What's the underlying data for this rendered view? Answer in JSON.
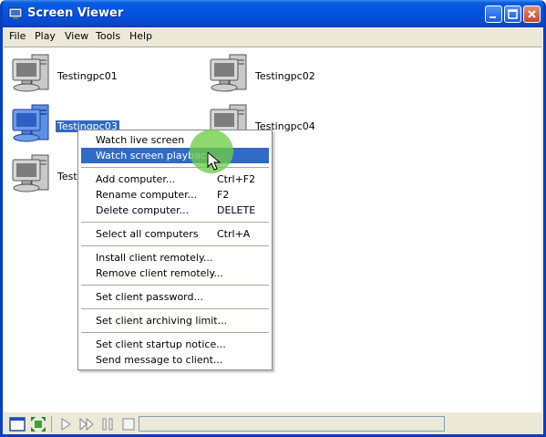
{
  "window": {
    "title": "Screen Viewer"
  },
  "menubar": [
    "File",
    "Play",
    "View",
    "Tools",
    "Help"
  ],
  "computers": [
    {
      "name": "Testingpc01",
      "selected": false
    },
    {
      "name": "Testingpc02",
      "selected": false
    },
    {
      "name": "Testingpc03",
      "selected": true
    },
    {
      "name": "Testingpc04",
      "selected": false
    },
    {
      "name": "Test",
      "selected": false
    }
  ],
  "context_menu": {
    "items": [
      {
        "label": "Watch live screen",
        "shortcut": ""
      },
      {
        "label": "Watch screen playback...",
        "shortcut": "",
        "highlighted": true
      },
      {
        "label": "Add computer...",
        "shortcut": "Ctrl+F2"
      },
      {
        "label": "Rename computer...",
        "shortcut": "F2"
      },
      {
        "label": "Delete computer...",
        "shortcut": "DELETE"
      },
      {
        "label": "Select all computers",
        "shortcut": "Ctrl+A"
      },
      {
        "label": "Install client remotely...",
        "shortcut": ""
      },
      {
        "label": "Remove client remotely...",
        "shortcut": ""
      },
      {
        "label": "Set client password...",
        "shortcut": ""
      },
      {
        "label": "Set client archiving limit...",
        "shortcut": ""
      },
      {
        "label": "Set client startup notice...",
        "shortcut": ""
      },
      {
        "label": "Send message to client...",
        "shortcut": ""
      }
    ]
  },
  "colors": {
    "titlebar": "#0a5ddc",
    "highlight": "#316ac5",
    "selected_pc": "#3d7be0"
  },
  "icons": [
    "app-icon",
    "minimize-icon",
    "maximize-icon",
    "close-icon",
    "computer-icon",
    "normal-view-icon",
    "fullscreen-icon",
    "play-icon",
    "fast-forward-icon",
    "pause-icon",
    "stop-icon"
  ]
}
